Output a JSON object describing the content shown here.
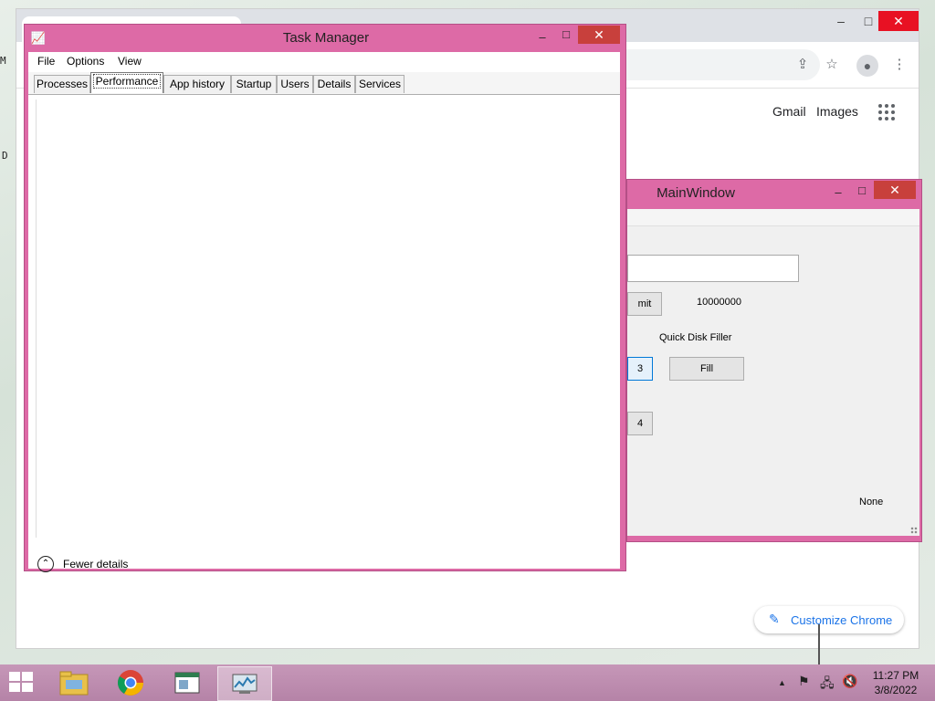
{
  "desktop": {
    "edge_letters": [
      "M",
      "D"
    ]
  },
  "chrome": {
    "controls": {
      "minimize": "–",
      "maximize": "□",
      "close": "✕"
    },
    "toolbar_icons": [
      "share-icon",
      "star-icon",
      "profile-icon",
      "more-icon"
    ],
    "links": {
      "gmail": "Gmail",
      "images": "Images"
    },
    "customize_label": "Customize Chrome"
  },
  "main_window": {
    "title": "MainWindow",
    "controls": {
      "minimize": "–",
      "maximize": "□",
      "close": "✕"
    },
    "submit_partial": "mit",
    "value_label": "10000000",
    "quick_fill_label": "Quick Disk Filler",
    "button_3": "3",
    "fill_button": "Fill",
    "button_4": "4",
    "status": "None"
  },
  "task_manager": {
    "title": "Task Manager",
    "controls": {
      "minimize": "–",
      "maximize": "□",
      "close": "✕"
    },
    "menu": {
      "file": "File",
      "options": "Options",
      "view": "View"
    },
    "tabs": [
      "Processes",
      "Performance",
      "App history",
      "Startup",
      "Users",
      "Details",
      "Services"
    ],
    "active_tab": "Performance",
    "fewer_details": "Fewer details"
  },
  "taskbar": {
    "clock_time": "11:27 PM",
    "clock_date": "3/8/2022",
    "tray_up_arrow": "▲"
  },
  "colors": {
    "window_frame": "#dd6aa6",
    "close_red": "#c8403c",
    "chrome_accent": "#1a73e8"
  }
}
